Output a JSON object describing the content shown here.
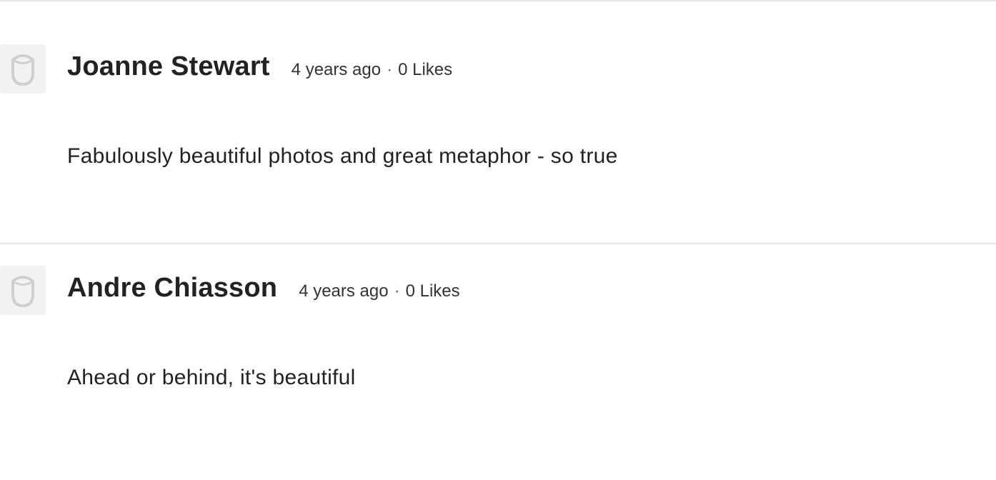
{
  "comments": [
    {
      "author": "Joanne Stewart",
      "time": "4 years ago",
      "separator": "·",
      "likes": "0 Likes",
      "text": "Fabulously beautiful photos and great metaphor - so true",
      "avatar_icon": "default-user-silhouette-icon"
    },
    {
      "author": "Andre Chiasson",
      "time": "4 years ago",
      "separator": "·",
      "likes": "0 Likes",
      "text": "Ahead or behind, it's beautiful",
      "avatar_icon": "default-user-silhouette-icon"
    }
  ],
  "colors": {
    "divider": "#e6e6e6",
    "avatar_bg": "#f2f2f2",
    "avatar_icon": "#cfcfcf",
    "text": "#222222"
  }
}
